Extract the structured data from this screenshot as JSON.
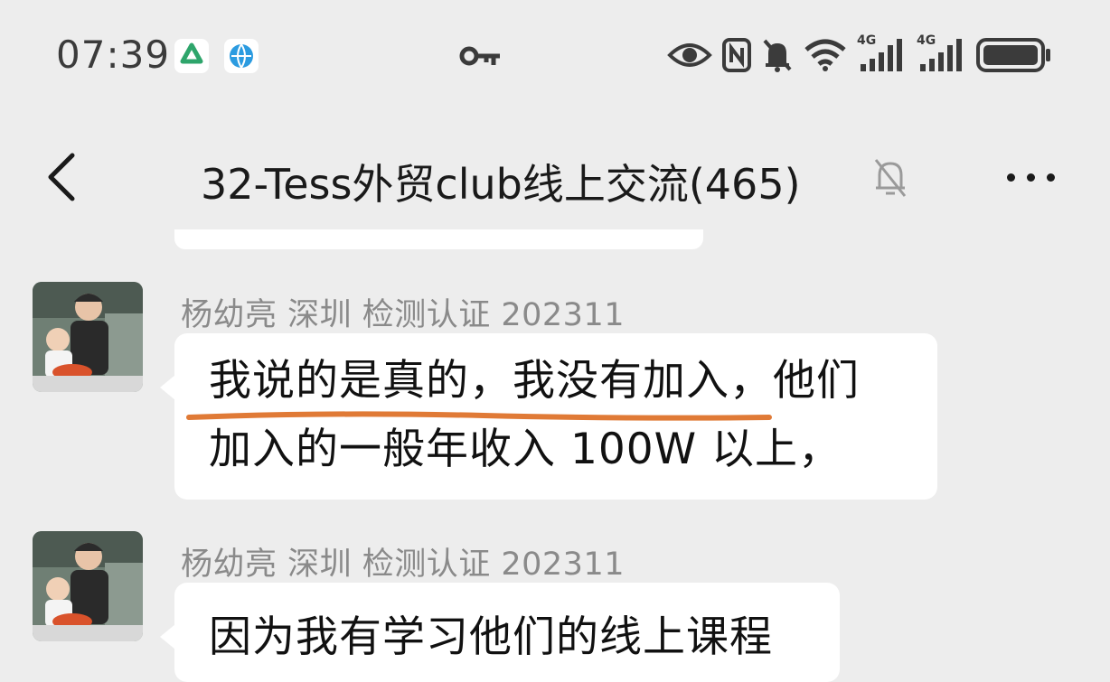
{
  "status_bar": {
    "time": "07:39",
    "icons": [
      "app-green-icon",
      "app-blue-globe-icon",
      "key-icon",
      "eye-icon",
      "nfc-icon",
      "bell-off-icon",
      "wifi-icon",
      "signal-4g-icon",
      "signal-4g-icon",
      "battery-icon"
    ],
    "network_labels": [
      "4G",
      "4G"
    ]
  },
  "header": {
    "title": "32-Tess外贸club线上交流(465)",
    "back_icon": "chevron-left-icon",
    "mute_icon": "bell-off-icon",
    "more_icon": "more-horizontal-icon"
  },
  "messages": [
    {
      "sender": "杨幼亮 深圳 检测认证 202311",
      "lines": [
        "我说的是真的，我没有加入，他们",
        "加入的一般年收入 100W 以上，"
      ],
      "highlight_color": "#e07a36"
    },
    {
      "sender": "杨幼亮 深圳 检测认证 202311",
      "lines": [
        "因为我有学习他们的线上课程"
      ]
    }
  ],
  "colors": {
    "background": "#ededed",
    "bubble": "#ffffff",
    "sender_text": "#8a8a8a",
    "underline": "#e07a36"
  }
}
